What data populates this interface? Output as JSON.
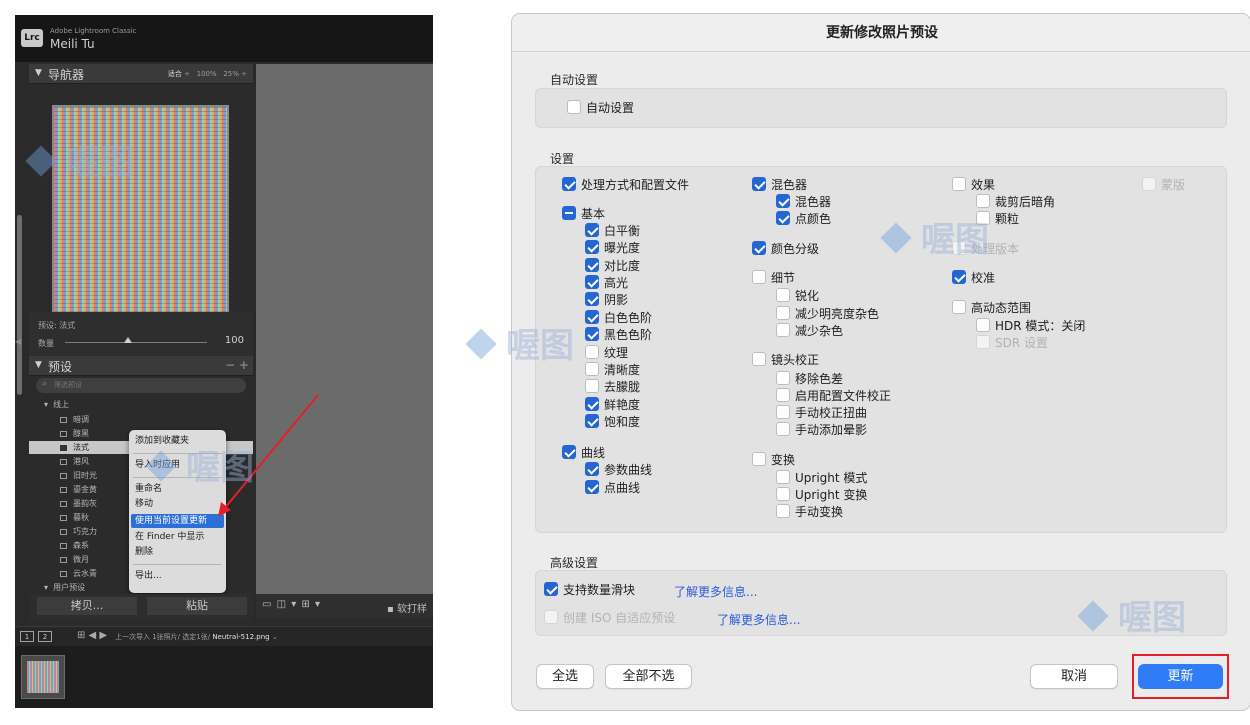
{
  "lightroom": {
    "app_name": "Adobe Lightroom Classic",
    "user_name": "Meili Tu",
    "logo": "Lrc",
    "navigator": {
      "title": "导航器",
      "zoom_fit": "适合",
      "zoom_100": "100%",
      "zoom_25": "25%"
    },
    "preset_amount": {
      "preset_label": "预设: 法式",
      "amount_label": "数量",
      "amount_value": "100"
    },
    "presets": {
      "title": "预设",
      "actions": "− +",
      "filter_placeholder": "筛选预设",
      "group_label": "线上",
      "items": [
        "暗调",
        "醇黑",
        "法式",
        "港风",
        "旧时光",
        "鎏金黄",
        "墨韵灰",
        "暮秋",
        "巧克力",
        "森系",
        "微月",
        "云水青"
      ],
      "selected": "法式",
      "user_group_label": "用户预设"
    },
    "context_menu": {
      "items": [
        "添加到收藏夹",
        "导入时应用",
        "重命名",
        "移动",
        "使用当前设置更新",
        "在 Finder 中显示",
        "删除",
        "导出..."
      ],
      "highlighted": "使用当前设置更新"
    },
    "bottom_buttons": {
      "copy": "拷贝...",
      "paste": "粘贴"
    },
    "toolbar": {
      "soft_proof": "软打样"
    },
    "filmstrip": {
      "page_1": "1",
      "page_2": "2",
      "info_prefix": "上一次导入  1张照片/ 选定1张/",
      "filename": "Neutral-512.png"
    }
  },
  "dialog": {
    "title": "更新修改照片预设",
    "auto_section": {
      "label": "自动设置",
      "checkbox": "自动设置"
    },
    "settings_section": {
      "label": "设置",
      "col1": {
        "process": "处理方式和配置文件",
        "basic": "基本",
        "basic_items": [
          "白平衡",
          "曝光度",
          "对比度",
          "高光",
          "阴影",
          "白色色阶",
          "黑色色阶",
          "纹理",
          "清晰度",
          "去朦胧",
          "鲜艳度",
          "饱和度"
        ],
        "curve": "曲线",
        "curve_items": [
          "参数曲线",
          "点曲线"
        ]
      },
      "col2": {
        "mixer": "混色器",
        "mixer_items": [
          "混色器",
          "点颜色"
        ],
        "grading": "颜色分级",
        "detail": "细节",
        "detail_items": [
          "锐化",
          "减少明亮度杂色",
          "减少杂色"
        ],
        "lens": "镜头校正",
        "lens_items": [
          "移除色差",
          "启用配置文件校正",
          "手动校正扭曲",
          "手动添加晕影"
        ],
        "transform": "变换",
        "transform_items": [
          "Upright 模式",
          "Upright 变换",
          "手动变换"
        ]
      },
      "col3": {
        "effects": "效果",
        "effects_items": [
          "裁剪后暗角",
          "颗粒"
        ],
        "process_version": "处理版本",
        "calibration": "校准",
        "hdr": "高动态范围",
        "hdr_items": [
          "HDR 模式：关闭",
          "SDR 设置"
        ]
      },
      "col4": {
        "mask": "蒙版"
      }
    },
    "advanced_section": {
      "label": "高级设置",
      "amount_slider": "支持数量滑块",
      "amount_link": "了解更多信息...",
      "iso": "创建 ISO 自适应预设",
      "iso_link": "了解更多信息..."
    },
    "buttons": {
      "select_all": "全选",
      "select_none": "全部不选",
      "cancel": "取消",
      "update": "更新"
    }
  },
  "watermark": {
    "text": "喔图"
  },
  "colors": {
    "accent_blue": "#2566d4",
    "update_button": "#2f7cf6",
    "highlight_red": "#e3202a",
    "lightroom_bg": "#2a2a2a"
  }
}
